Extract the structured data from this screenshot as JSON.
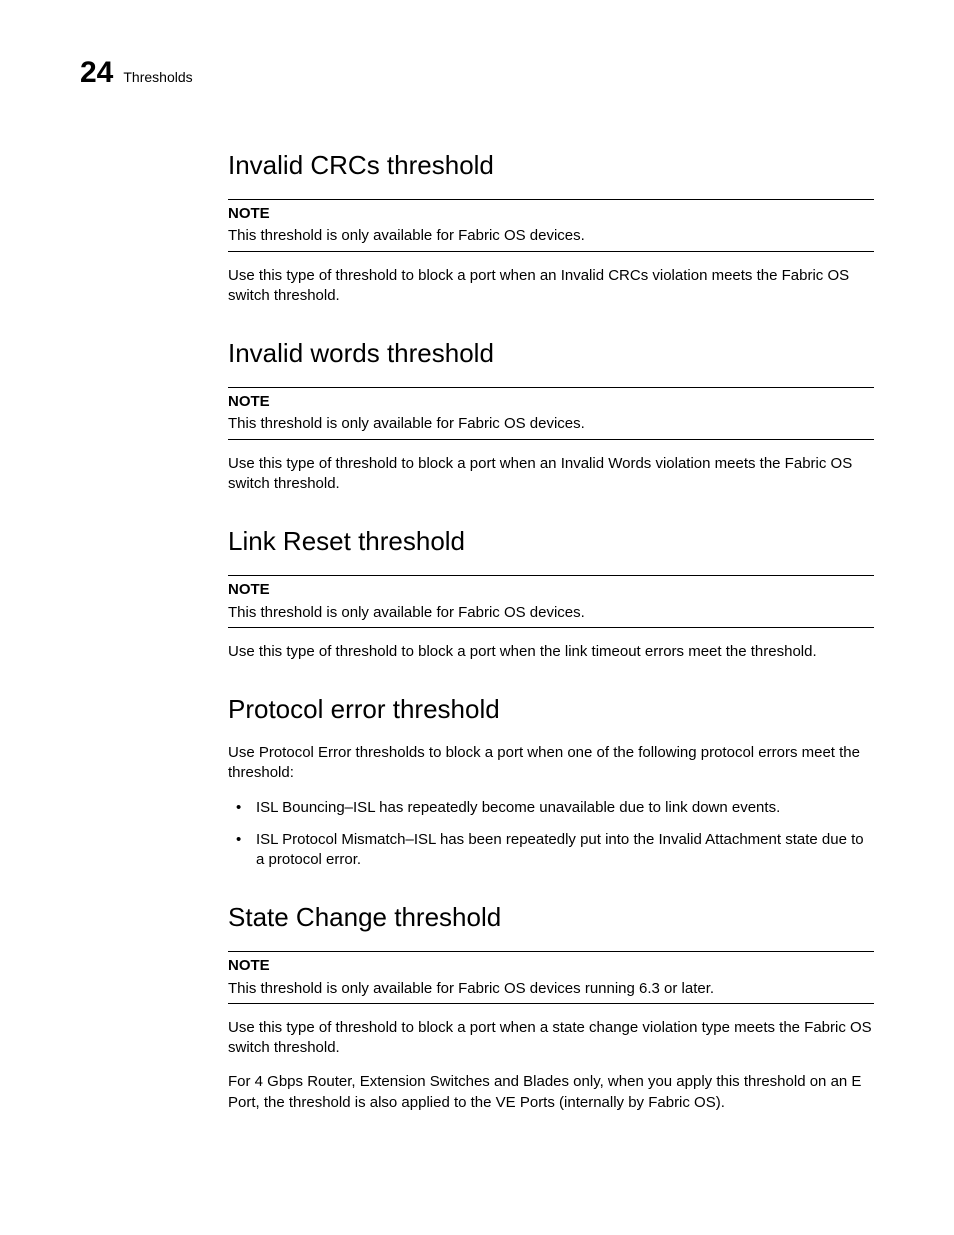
{
  "header": {
    "chapter_number": "24",
    "title": "Thresholds"
  },
  "sections": {
    "invalid_crcs": {
      "heading": "Invalid CRCs threshold",
      "note_label": "NOTE",
      "note_text": "This threshold is only available for Fabric OS devices.",
      "body": "Use this type of threshold to block a port when an Invalid CRCs violation meets the Fabric OS switch threshold."
    },
    "invalid_words": {
      "heading": "Invalid words threshold",
      "note_label": "NOTE",
      "note_text": "This threshold is only available for Fabric OS devices.",
      "body": "Use this type of threshold to block a port when an Invalid Words violation meets the Fabric OS switch threshold."
    },
    "link_reset": {
      "heading": "Link Reset threshold",
      "note_label": "NOTE",
      "note_text": "This threshold is only available for Fabric OS devices.",
      "body": "Use this type of threshold to block a port when the link timeout errors meet the threshold."
    },
    "protocol_error": {
      "heading": "Protocol error threshold",
      "body": "Use Protocol Error thresholds to block a port when one of the following protocol errors meet the threshold:",
      "bullets": [
        "ISL Bouncing–ISL has repeatedly become unavailable due to link down events.",
        "ISL Protocol Mismatch–ISL has been repeatedly put into the Invalid Attachment state due to a protocol error."
      ]
    },
    "state_change": {
      "heading": "State Change threshold",
      "note_label": "NOTE",
      "note_text": "This threshold is only available for Fabric OS devices running 6.3 or later.",
      "body1": "Use this type of threshold to block a port when a state change violation type meets the Fabric OS switch threshold.",
      "body2": "For 4 Gbps Router, Extension Switches and Blades only, when you apply this threshold on an E Port, the threshold is also applied to the VE Ports (internally by Fabric OS)."
    }
  }
}
